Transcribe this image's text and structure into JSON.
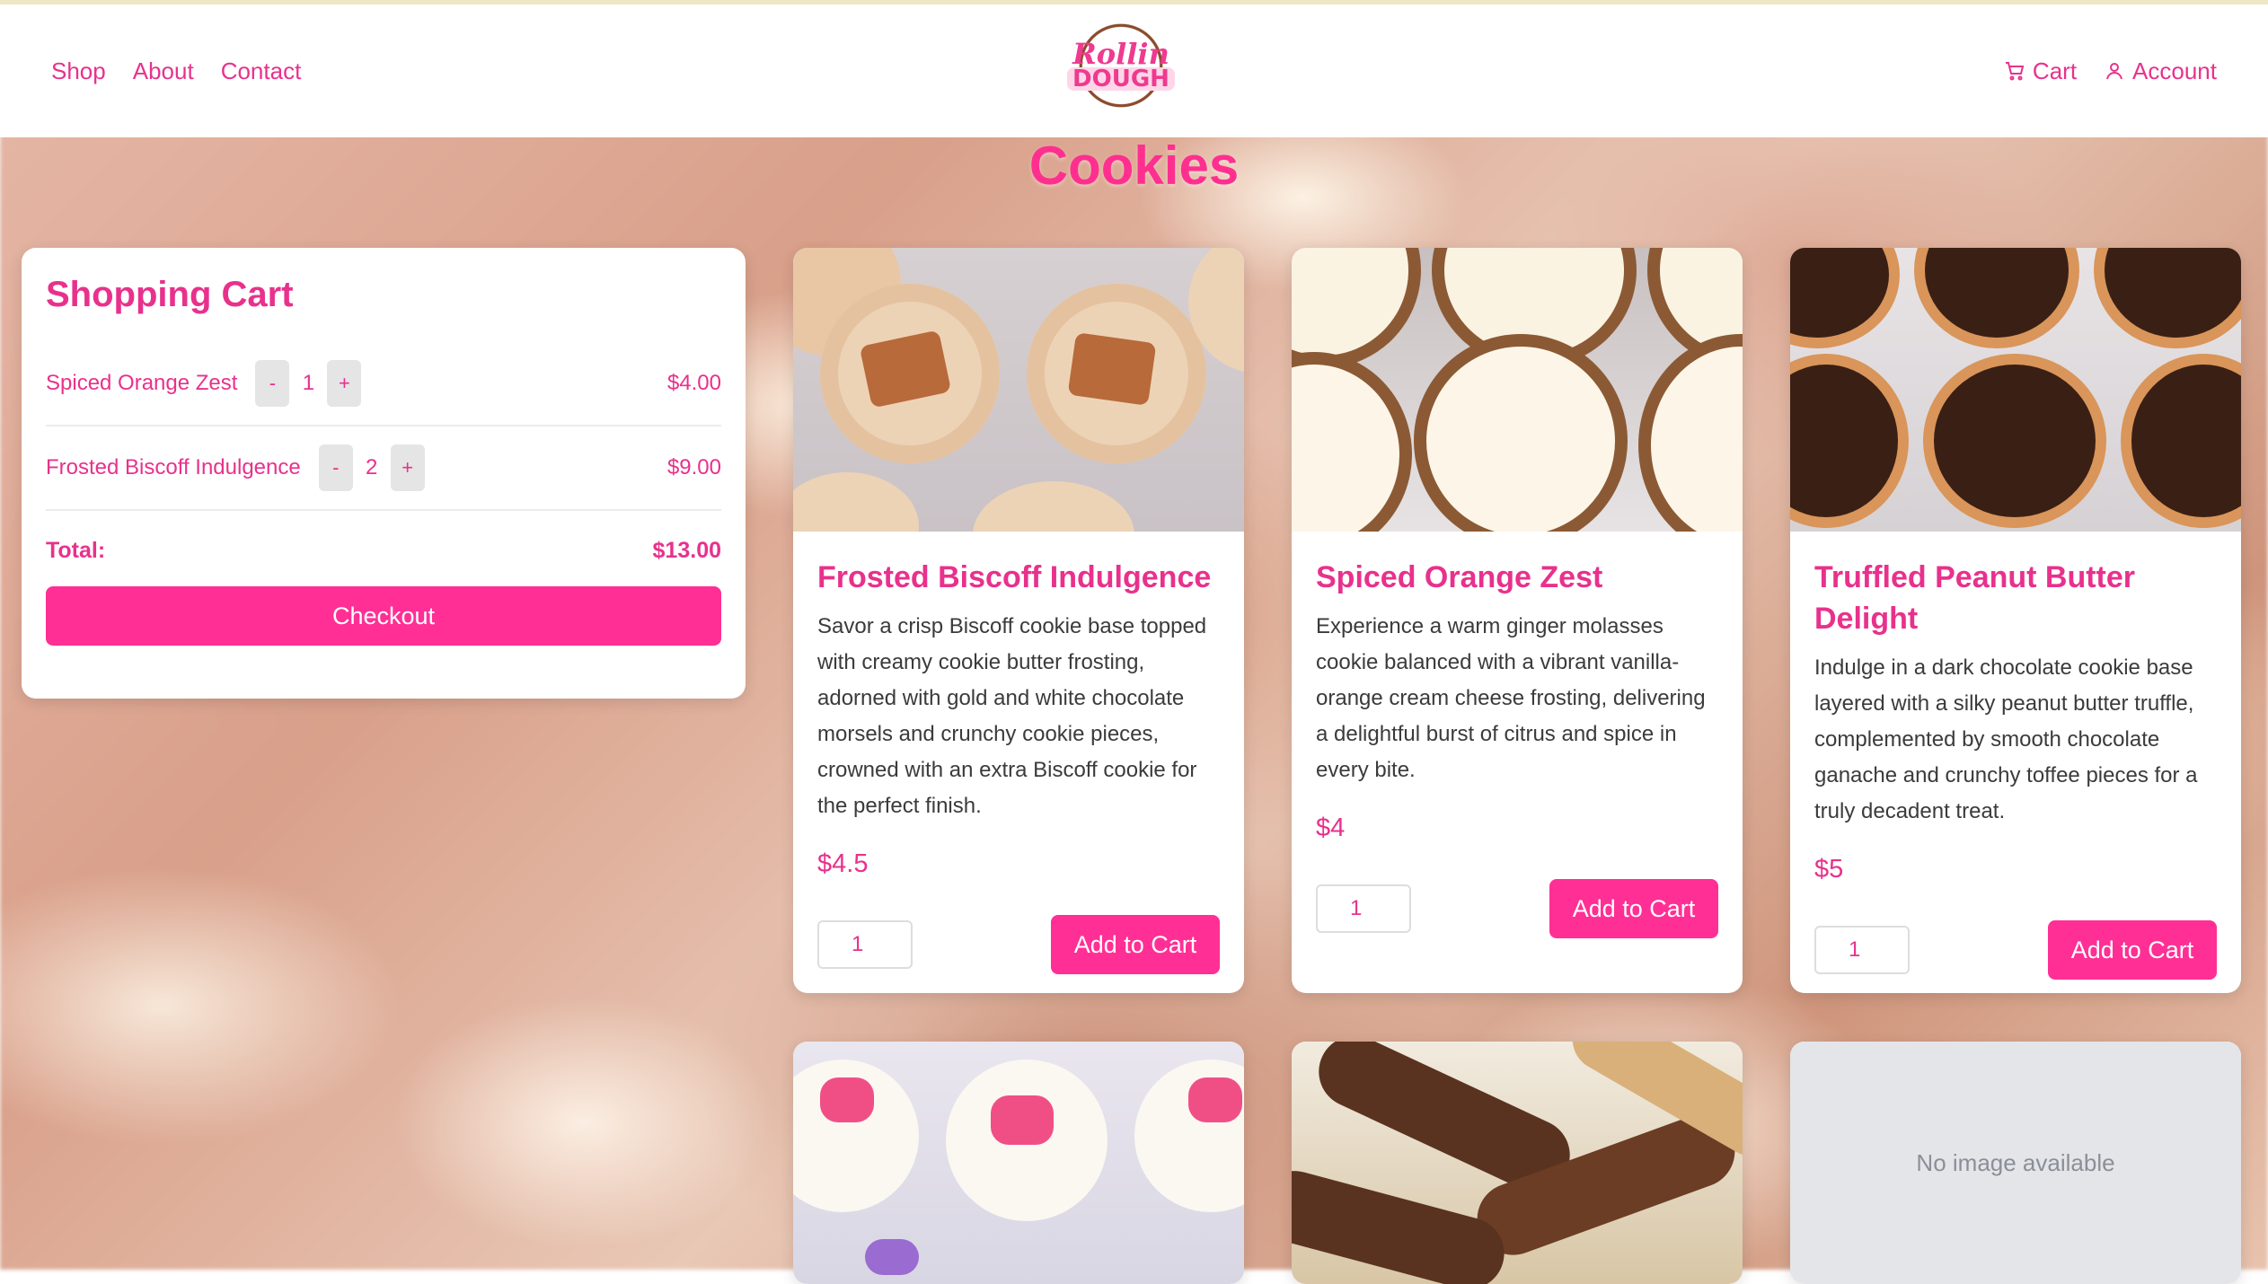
{
  "header": {
    "nav_left": [
      "Shop",
      "About",
      "Contact"
    ],
    "logo_line1": "Rollin",
    "logo_line2": "DOUGH",
    "cart_label": "Cart",
    "account_label": "Account"
  },
  "page_title": "Cookies",
  "cart": {
    "title": "Shopping Cart",
    "items": [
      {
        "name": "Spiced Orange Zest",
        "qty": "1",
        "price": "$4.00"
      },
      {
        "name": "Frosted Biscoff Indulgence",
        "qty": "2",
        "price": "$9.00"
      }
    ],
    "minus": "-",
    "plus": "+",
    "total_label": "Total:",
    "total_value": "$13.00",
    "checkout_label": "Checkout"
  },
  "products": [
    {
      "title": "Frosted Biscoff Indulgence",
      "description": "Savor a crisp Biscoff cookie base topped with creamy cookie butter frosting, adorned with gold and white chocolate morsels and crunchy cookie pieces, crowned with an extra Biscoff cookie for the perfect finish.",
      "price": "$4.5",
      "qty": "1",
      "button": "Add to Cart"
    },
    {
      "title": "Spiced Orange Zest",
      "description": "Experience a warm ginger molasses cookie balanced with a vibrant vanilla-orange cream cheese frosting, delivering a delightful burst of citrus and spice in every bite.",
      "price": "$4",
      "qty": "1",
      "button": "Add to Cart"
    },
    {
      "title": "Truffled Peanut Butter Delight",
      "description": "Indulge in a dark chocolate cookie base layered with a silky peanut butter truffle, complemented by smooth chocolate ganache and crunchy toffee pieces for a truly decadent treat.",
      "price": "$5",
      "qty": "1",
      "button": "Add to Cart"
    }
  ],
  "placeholder_text": "No image available",
  "colors": {
    "accent": "#ff2f95",
    "text_pink": "#e8318c"
  }
}
